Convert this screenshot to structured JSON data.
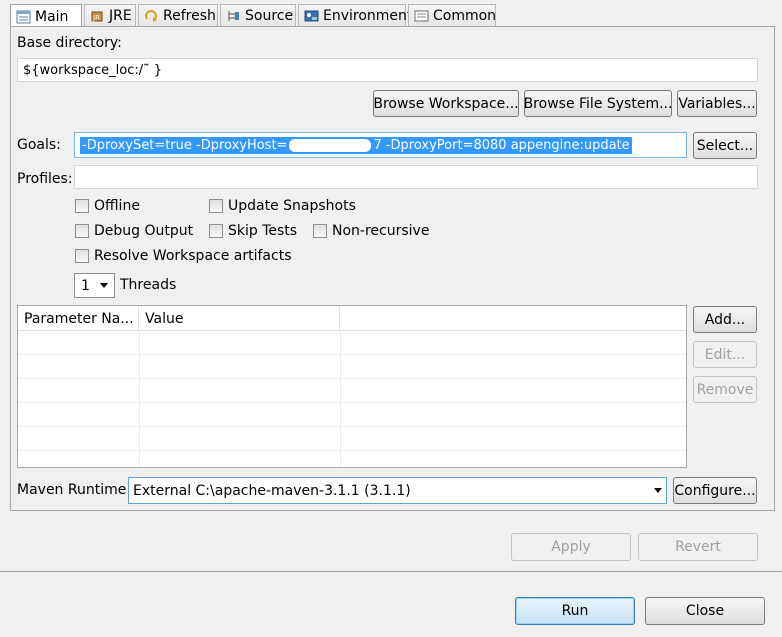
{
  "tabs": [
    {
      "label": "Main",
      "icon": "main-tab-icon"
    },
    {
      "label": "JRE",
      "icon": "jre-icon"
    },
    {
      "label": "Refresh",
      "icon": "refresh-icon"
    },
    {
      "label": "Source",
      "icon": "source-icon"
    },
    {
      "label": "Environment",
      "icon": "environment-icon"
    },
    {
      "label": "Common",
      "icon": "common-icon"
    }
  ],
  "base_directory": {
    "label": "Base directory:",
    "value": "${workspace_loc:/˜                                         }"
  },
  "browse_buttons": {
    "workspace": "Browse Workspace...",
    "file_system": "Browse File System...",
    "variables": "Variables..."
  },
  "goals": {
    "label": "Goals:",
    "value_part1": "-DproxySet=true -DproxyHost=",
    "value_part2": "7 -DproxyPort=8080 appengine:update",
    "select_button": "Select..."
  },
  "profiles": {
    "label": "Profiles:",
    "value": ""
  },
  "options": {
    "offline": "Offline",
    "update_snapshots": "Update Snapshots",
    "debug_output": "Debug Output",
    "skip_tests": "Skip Tests",
    "non_recursive": "Non-recursive",
    "resolve_workspace": "Resolve Workspace artifacts"
  },
  "threads": {
    "value": "1",
    "label": "Threads"
  },
  "parameters_table": {
    "columns": [
      "Parameter Na...",
      "Value",
      ""
    ],
    "rows": []
  },
  "table_buttons": {
    "add": "Add...",
    "edit": "Edit...",
    "remove": "Remove"
  },
  "maven_runtime": {
    "label": "Maven Runtime:",
    "value": "External C:\\apache-maven-3.1.1 (3.1.1)",
    "configure_button": "Configure..."
  },
  "footer": {
    "apply": "Apply",
    "revert": "Revert",
    "run": "Run",
    "close": "Close"
  },
  "colors": {
    "selection": "#3399ff",
    "window_bg": "#f0f0f0"
  }
}
